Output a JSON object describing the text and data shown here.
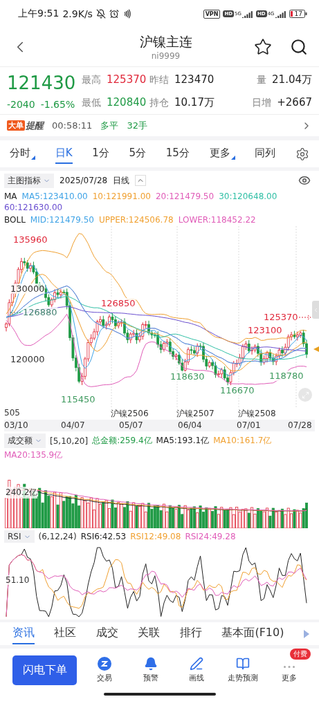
{
  "status_bar": {
    "time": "上午9:51",
    "speed": "2.9K/s",
    "vpn": "VPN",
    "networks": [
      {
        "hd": "HD",
        "gen": "5G"
      },
      {
        "hd": "HD",
        "gen": "4G"
      }
    ],
    "battery": "17"
  },
  "header": {
    "title": "沪镍主连",
    "code": "ni9999"
  },
  "quote": {
    "price": "121430",
    "change": "-2040",
    "change_pct": "-1.65%",
    "color": "#1f9a45",
    "stats": [
      {
        "label": "最高",
        "value": "125370",
        "color": "#e0283a"
      },
      {
        "label": "昨结",
        "value": "123470",
        "color": "#222222"
      },
      {
        "label": "量",
        "value": "21.04万",
        "color": "#222222"
      },
      {
        "label": "最低",
        "value": "120840",
        "color": "#1f9a45"
      },
      {
        "label": "持仓",
        "value": "10.17万",
        "color": "#222222"
      },
      {
        "label": "日增",
        "value": "+2667",
        "color": "#222222"
      }
    ]
  },
  "alert": {
    "tag": "大单",
    "tag_text": "提醒",
    "time": "00:58:11",
    "action": "多平",
    "size": "32手"
  },
  "period_tabs": [
    {
      "label": "分时",
      "selected": false,
      "dropdown": true
    },
    {
      "label": "日K",
      "selected": true,
      "dropdown": false
    },
    {
      "label": "1分",
      "selected": false,
      "dropdown": false
    },
    {
      "label": "5分",
      "selected": false,
      "dropdown": false
    },
    {
      "label": "15分",
      "selected": false,
      "dropdown": false
    },
    {
      "label": "更多",
      "selected": false,
      "dropdown": true
    },
    {
      "label": "同列",
      "selected": false,
      "dropdown": false
    }
  ],
  "indicator_bar": {
    "selector": "主图指标",
    "date": "2025/07/28",
    "period": "日线"
  },
  "ma_legend": {
    "name": "MA",
    "items": [
      {
        "text": "MA5:123410.00",
        "color": "#3fa3e6"
      },
      {
        "text": "10:121991.00",
        "color": "#f0a030"
      },
      {
        "text": "20:121479.50",
        "color": "#e05cb8"
      },
      {
        "text": "30:120648.00",
        "color": "#2fbfa5"
      },
      {
        "text": "60:121630.00",
        "color": "#6a4fd0"
      }
    ]
  },
  "boll_legend": {
    "name": "BOLL",
    "items": [
      {
        "text": "MID:121479.50",
        "color": "#3fa3e6"
      },
      {
        "text": "UPPER:124506.78",
        "color": "#f0a030"
      },
      {
        "text": "LOWER:118452.22",
        "color": "#e05cb8"
      }
    ]
  },
  "price_chart": {
    "labels": [
      {
        "text": "135960",
        "kind": "peak"
      },
      {
        "text": "130000",
        "kind": "axis"
      },
      {
        "text": "126850",
        "kind": "peak"
      },
      {
        "text": "126880",
        "kind": "prior-marker"
      },
      {
        "text": "125370",
        "kind": "latest-high"
      },
      {
        "text": "123100",
        "kind": "peak"
      },
      {
        "text": "120000",
        "kind": "axis"
      },
      {
        "text": "118780",
        "kind": "trough"
      },
      {
        "text": "118630",
        "kind": "trough"
      },
      {
        "text": "116670",
        "kind": "trough"
      },
      {
        "text": "115450",
        "kind": "trough"
      }
    ],
    "contracts": [
      "505",
      "沪镍2506",
      "沪镍2507",
      "沪镍2508"
    ],
    "dates": [
      "03/10",
      "04/07",
      "05/07",
      "06/04",
      "07/01",
      "07/28"
    ]
  },
  "volume": {
    "selector": "成交额",
    "params": "[5,10,20]",
    "legend": [
      {
        "text": "总金额:259.4亿",
        "color": "#1f9a45"
      },
      {
        "text": "MA5:193.1亿",
        "color": "#222222"
      },
      {
        "text": "MA10:161.7亿",
        "color": "#f0a030"
      },
      {
        "text": "MA20:135.9亿",
        "color": "#e05cb8"
      }
    ],
    "axis_label": "240.2亿"
  },
  "rsi": {
    "selector": "RSI",
    "params": "(6,12,24)",
    "legend": [
      {
        "text": "RSI6:42.53",
        "color": "#222222"
      },
      {
        "text": "RSI12:49.08",
        "color": "#f0a030"
      },
      {
        "text": "RSI24:49.28",
        "color": "#e05cb8"
      }
    ],
    "axis_label": "51.10"
  },
  "info_tabs": [
    {
      "label": "资讯",
      "selected": true
    },
    {
      "label": "社区",
      "selected": false
    },
    {
      "label": "成交",
      "selected": false
    },
    {
      "label": "关联",
      "selected": false
    },
    {
      "label": "排行",
      "selected": false
    },
    {
      "label": "基本面(F10)",
      "selected": false
    }
  ],
  "actions": {
    "primary": "闪电下单",
    "items": [
      {
        "label": "交易",
        "kind": "trade"
      },
      {
        "label": "预警",
        "kind": "alert"
      },
      {
        "label": "画线",
        "kind": "draw"
      },
      {
        "label": "走势预测",
        "kind": "forecast"
      },
      {
        "label": "更多",
        "kind": "more",
        "badge": "付费"
      }
    ]
  }
}
